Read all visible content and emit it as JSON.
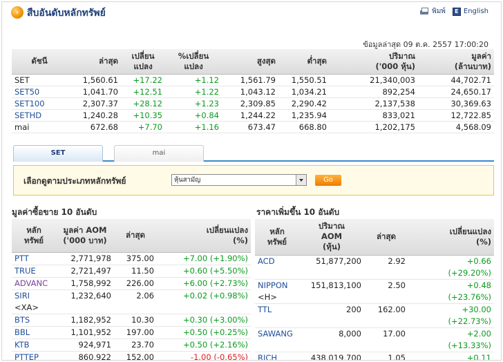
{
  "header": {
    "title": "สืบอันดับหลักทรัพย์",
    "print_label": "พิมพ์",
    "english_label": "English"
  },
  "asof": "ข้อมูลล่าสุด 09 ต.ค. 2557 17:00:20",
  "index_table": {
    "headers": [
      "ดัชนี",
      "ล่าสุด",
      "เปลี่ยน\nแปลง",
      "%เปลี่ยน\nแปลง",
      "สูงสุด",
      "ต่ำสุด",
      "ปริมาณ\n('000 หุ้น)",
      "มูลค่า\n(ล้านบาท)"
    ],
    "rows": [
      {
        "name": "SET",
        "last": "1,560.61",
        "chg": "+17.22",
        "pct": "+1.12",
        "high": "1,561.79",
        "low": "1,550.51",
        "vol": "21,340,003",
        "val": "44,702.71"
      },
      {
        "name": "SET50",
        "last": "1,041.70",
        "chg": "+12.51",
        "pct": "+1.22",
        "high": "1,043.12",
        "low": "1,034.21",
        "vol": "892,254",
        "val": "24,650.17"
      },
      {
        "name": "SET100",
        "last": "2,307.37",
        "chg": "+28.12",
        "pct": "+1.23",
        "high": "2,309.85",
        "low": "2,290.42",
        "vol": "2,137,538",
        "val": "30,369.63"
      },
      {
        "name": "SETHD",
        "last": "1,240.28",
        "chg": "+10.35",
        "pct": "+0.84",
        "high": "1,244.22",
        "low": "1,235.94",
        "vol": "833,021",
        "val": "12,722.85"
      },
      {
        "name": "mai",
        "last": "672.68",
        "chg": "+7.70",
        "pct": "+1.16",
        "high": "673.47",
        "low": "668.80",
        "vol": "1,202,175",
        "val": "4,568.09"
      }
    ]
  },
  "tabs": [
    {
      "label": "SET",
      "active": true
    },
    {
      "label": "mai",
      "active": false
    }
  ],
  "filter": {
    "label": "เลือกดูตามประเภทหลักทรัพย์",
    "selected": "หุ้นสามัญ",
    "go_label": "Go"
  },
  "top_value": {
    "title": "มูลค่าซื้อขาย 10 อันดับ",
    "headers": [
      "หลัก\nทรัพย์",
      "มูลค่า AOM\n('000 บาท)",
      "ล่าสุด",
      "เปลี่ยนแปลง\n(%)"
    ],
    "rows": [
      {
        "sym": "PTT",
        "sym2": "",
        "val": "2,771,978",
        "last": "375.00",
        "chg": "+7.00 (+1.90%)",
        "dir": "pos",
        "symcolor": "blue"
      },
      {
        "sym": "TRUE",
        "sym2": "",
        "val": "2,721,497",
        "last": "11.50",
        "chg": "+0.60 (+5.50%)",
        "dir": "pos",
        "symcolor": "blue"
      },
      {
        "sym": "ADVANC",
        "sym2": "",
        "val": "1,758,992",
        "last": "226.00",
        "chg": "+6.00 (+2.73%)",
        "dir": "pos",
        "symcolor": "purple"
      },
      {
        "sym": "SIRI",
        "sym2": "<XA>",
        "val": "1,232,640",
        "last": "2.06",
        "chg": "+0.02 (+0.98%)",
        "dir": "pos",
        "symcolor": "blue"
      },
      {
        "sym": "BTS",
        "sym2": "",
        "val": "1,182,952",
        "last": "10.30",
        "chg": "+0.30 (+3.00%)",
        "dir": "pos",
        "symcolor": "blue"
      },
      {
        "sym": "BBL",
        "sym2": "",
        "val": "1,101,952",
        "last": "197.00",
        "chg": "+0.50 (+0.25%)",
        "dir": "pos",
        "symcolor": "blue"
      },
      {
        "sym": "KTB",
        "sym2": "",
        "val": "924,971",
        "last": "23.70",
        "chg": "+0.50 (+2.16%)",
        "dir": "pos",
        "symcolor": "blue"
      },
      {
        "sym": "PTTEP",
        "sym2": "",
        "val": "860,922",
        "last": "152.00",
        "chg": "-1.00 (-0.65%)",
        "dir": "neg",
        "symcolor": "blue"
      }
    ]
  },
  "top_gainers": {
    "title": "ราคาเพิ่มขึ้น 10 อันดับ",
    "headers": [
      "หลัก\nทรัพย์",
      "ปริมาณ\nAOM\n(หุ้น)",
      "ล่าสุด",
      "เปลี่ยนแปลง\n(%)"
    ],
    "rows": [
      {
        "sym": "ACD",
        "sym2": "",
        "vol": "51,877,200",
        "last": "2.92",
        "chg": "+0.66",
        "pct": "(+29.20%)"
      },
      {
        "sym": "NIPPON",
        "sym2": "<H>",
        "vol": "151,813,100",
        "last": "2.50",
        "chg": "+0.48",
        "pct": "(+23.76%)"
      },
      {
        "sym": "TTL",
        "sym2": "",
        "vol": "200",
        "last": "162.00",
        "chg": "+30.00",
        "pct": "(+22.73%)"
      },
      {
        "sym": "SAWANG",
        "sym2": "",
        "vol": "8,000",
        "last": "17.00",
        "chg": "+2.00",
        "pct": "(+13.33%)"
      },
      {
        "sym": "RICH",
        "sym2": "",
        "vol": "438,019,700",
        "last": "1.05",
        "chg": "+0.11",
        "pct": ""
      }
    ]
  },
  "colors": {
    "positive": "#0a9b1e",
    "negative": "#e11b1b",
    "link": "#1f4f99",
    "accent": "#f39200"
  }
}
